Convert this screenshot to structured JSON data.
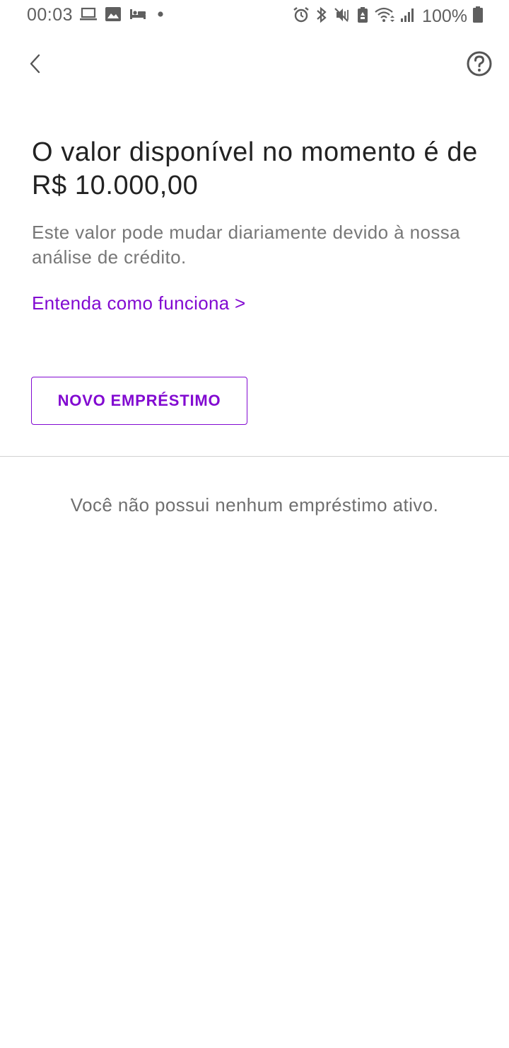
{
  "status_bar": {
    "time": "00:03",
    "battery_percent": "100%",
    "left_icons": [
      "laptop-icon",
      "image-icon",
      "bed-icon",
      "dot-icon"
    ],
    "right_icons": [
      "alarm-icon",
      "bluetooth-icon",
      "mute-icon",
      "battery-saver-icon",
      "wifi-icon",
      "signal-icon",
      "battery-icon"
    ]
  },
  "app_bar": {
    "back_icon": "chevron-left-icon",
    "help_icon": "help-circle-icon"
  },
  "content": {
    "headline": "O valor disponível no momento é de R$ 10.000,00",
    "description": "Este valor pode mudar diariamente devido à nossa análise de crédito.",
    "link_text": "Entenda como funciona >",
    "button_label": "NOVO EMPRÉSTIMO",
    "empty_state": "Você não possui nenhum empréstimo ativo."
  },
  "colors": {
    "accent": "#820ad1",
    "text_primary": "#222222",
    "text_secondary": "#777777",
    "divider": "#d2d2d2",
    "background": "#ffffff"
  }
}
